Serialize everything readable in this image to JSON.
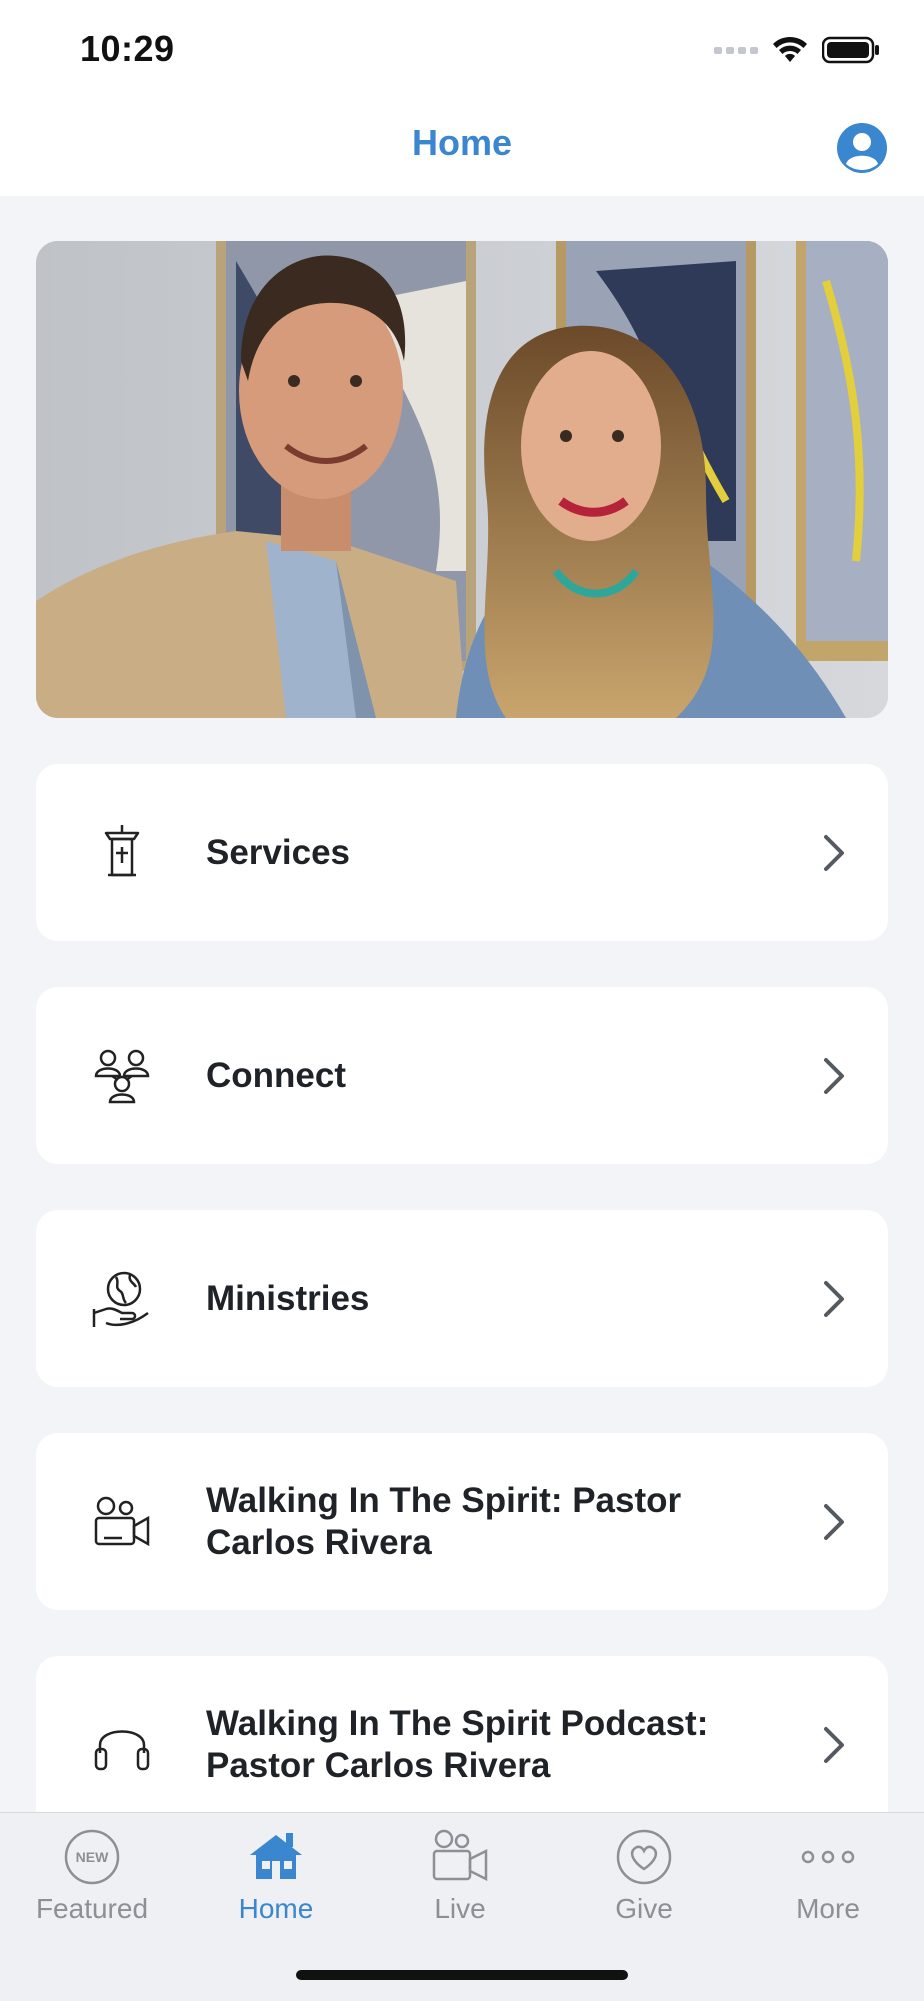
{
  "status_bar": {
    "time": "10:29"
  },
  "header": {
    "title": "Home",
    "profile_icon": "person-circle-icon"
  },
  "hero": {
    "image": "photo of a smiling man in a tan blazer and a woman with long wavy hair"
  },
  "menu": [
    {
      "label": "Services",
      "icon": "pulpit-icon"
    },
    {
      "label": "Connect",
      "icon": "group-people-icon"
    },
    {
      "label": "Ministries",
      "icon": "globe-hand-icon"
    },
    {
      "label": "Walking In The Spirit: Pastor Carlos Rivera",
      "icon": "video-camera-person-icon"
    },
    {
      "label": "Walking In The Spirit Podcast: Pastor Carlos Rivera",
      "icon": "headphones-icon"
    }
  ],
  "tabs": [
    {
      "label": "Featured",
      "icon": "new-badge-icon",
      "active": false
    },
    {
      "label": "Home",
      "icon": "house-icon",
      "active": true
    },
    {
      "label": "Live",
      "icon": "video-camera-icon",
      "active": false
    },
    {
      "label": "Give",
      "icon": "heart-circle-icon",
      "active": false
    },
    {
      "label": "More",
      "icon": "ellipsis-icon",
      "active": false
    }
  ],
  "colors": {
    "accent": "#3a86cf",
    "background": "#f2f4f7",
    "card": "#ffffff",
    "tab_inactive": "#8c9096"
  }
}
